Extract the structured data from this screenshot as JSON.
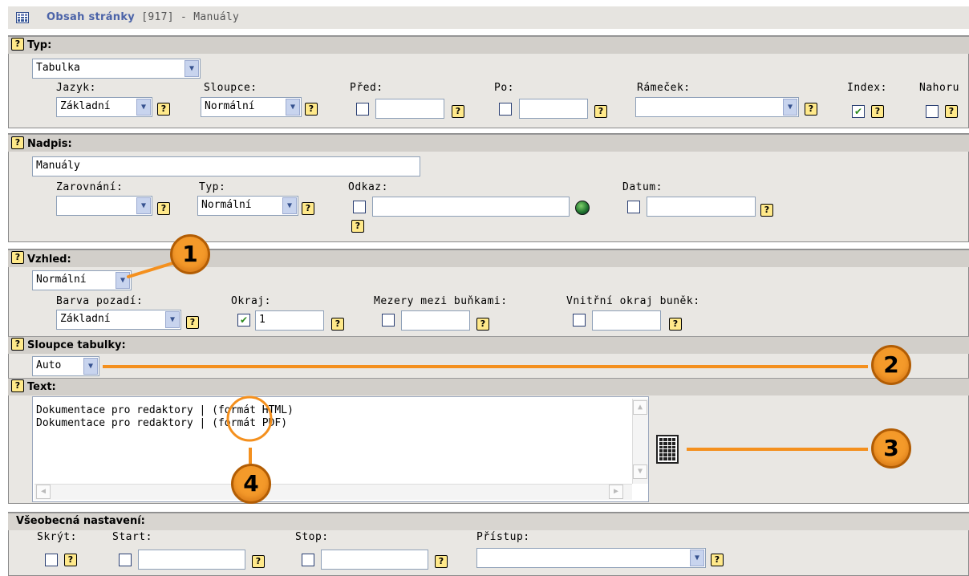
{
  "title": {
    "app": "Obsah stránky",
    "id": "[917]",
    "rest": "- Manuály"
  },
  "help_glyph": "?",
  "typ": {
    "label": "Typ:",
    "value": "Tabulka",
    "jazyk_label": "Jazyk:",
    "jazyk_value": "Základní",
    "sloupce_label": "Sloupce:",
    "sloupce_value": "Normální",
    "pred_label": "Před:",
    "po_label": "Po:",
    "ramecek_label": "Rámeček:",
    "ramecek_value": "",
    "index_label": "Index:",
    "index_checked": true,
    "nahoru_label": "Nahoru",
    "nahoru_checked": false
  },
  "nadpis": {
    "label": "Nadpis:",
    "value": "Manuály",
    "zarovnani_label": "Zarovnání:",
    "zarovnani_value": "",
    "typ_label": "Typ:",
    "typ_value": "Normální",
    "odkaz_label": "Odkaz:",
    "datum_label": "Datum:"
  },
  "vzhled": {
    "label": "Vzhled:",
    "value": "Normální",
    "barva_label": "Barva pozadí:",
    "barva_value": "Základní",
    "okraj_label": "Okraj:",
    "okraj_checked": true,
    "okraj_value": "1",
    "mezery_label": "Mezery mezi buňkami:",
    "vnitrni_label": "Vnitřní okraj buněk:"
  },
  "sloupce_tabulky": {
    "label": "Sloupce tabulky:",
    "value": "Auto"
  },
  "text": {
    "label": "Text:",
    "lines": [
      "Dokumentace pro redaktory | (formát HTML)",
      "Dokumentace pro redaktory | (formát PDF)"
    ]
  },
  "vseobecna": {
    "label": "Všeobecná nastavení:",
    "skryt_label": "Skrýt:",
    "start_label": "Start:",
    "stop_label": "Stop:",
    "pristup_label": "Přístup:",
    "pristup_value": ""
  },
  "callouts": [
    "1",
    "2",
    "3",
    "4"
  ],
  "colors": {
    "accent": "#f49a2a",
    "title_link": "#4b63a8",
    "panel": "#e9e7e3",
    "section_header": "#d2cfca",
    "help_icon": "#ffe98a"
  }
}
